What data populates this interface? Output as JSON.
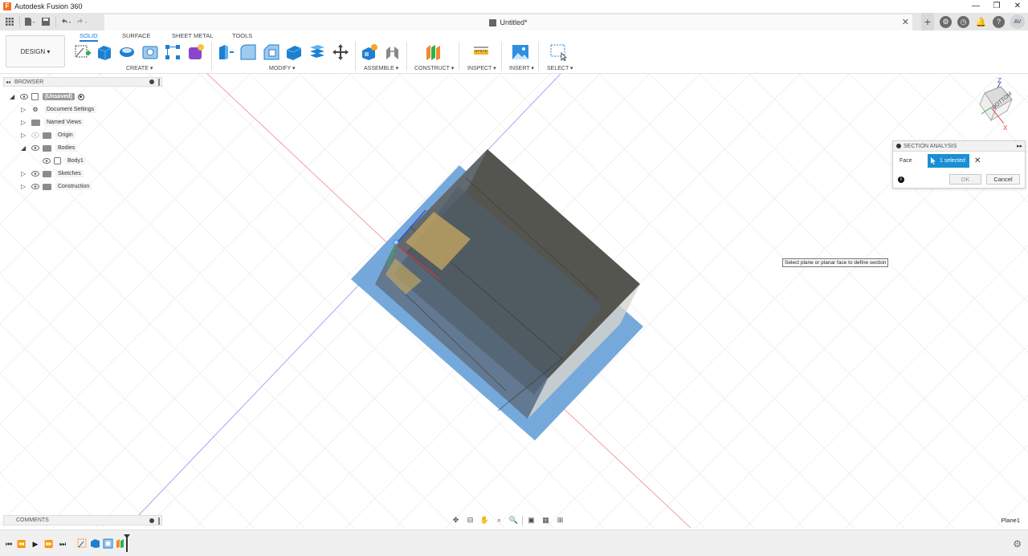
{
  "app": {
    "title": "Autodesk Fusion 360",
    "logo_letter": "F"
  },
  "window_controls": {
    "minimize": "—",
    "maximize": "❐",
    "close": "✕"
  },
  "document": {
    "title": "Untitled*"
  },
  "user": {
    "initials": "AV"
  },
  "toolbar": {
    "design_label": "DESIGN ▾",
    "workspace_tabs": [
      "SOLID",
      "SURFACE",
      "SHEET METAL",
      "TOOLS"
    ],
    "groups": {
      "create": "CREATE ▾",
      "modify": "MODIFY ▾",
      "assemble": "ASSEMBLE ▾",
      "construct": "CONSTRUCT ▾",
      "inspect": "INSPECT ▾",
      "insert": "INSERT ▾",
      "select": "SELECT ▾"
    }
  },
  "browser": {
    "title": "BROWSER",
    "items": [
      {
        "label": "(Unsaved)"
      },
      {
        "label": "Document Settings"
      },
      {
        "label": "Named Views"
      },
      {
        "label": "Origin"
      },
      {
        "label": "Bodies"
      },
      {
        "label": "Body1"
      },
      {
        "label": "Sketches"
      },
      {
        "label": "Construction"
      }
    ]
  },
  "section_analysis": {
    "title": "SECTION ANALYSIS",
    "face_label": "Face",
    "selection": "1 selected",
    "clear": "✕",
    "ok_label": "OK",
    "cancel_label": "Cancel",
    "info": "i"
  },
  "tooltip": "Select plane or planar face to define section",
  "comments": {
    "title": "COMMENTS"
  },
  "status": {
    "plane_label": "Plane1"
  },
  "viewcube": {
    "face_label": "BOTTOM",
    "axis_z": "Z",
    "axis_x": "X"
  },
  "colors": {
    "accent": "#1a8fd6",
    "plane": "#6fa4d9",
    "body_dark": "#555550"
  }
}
